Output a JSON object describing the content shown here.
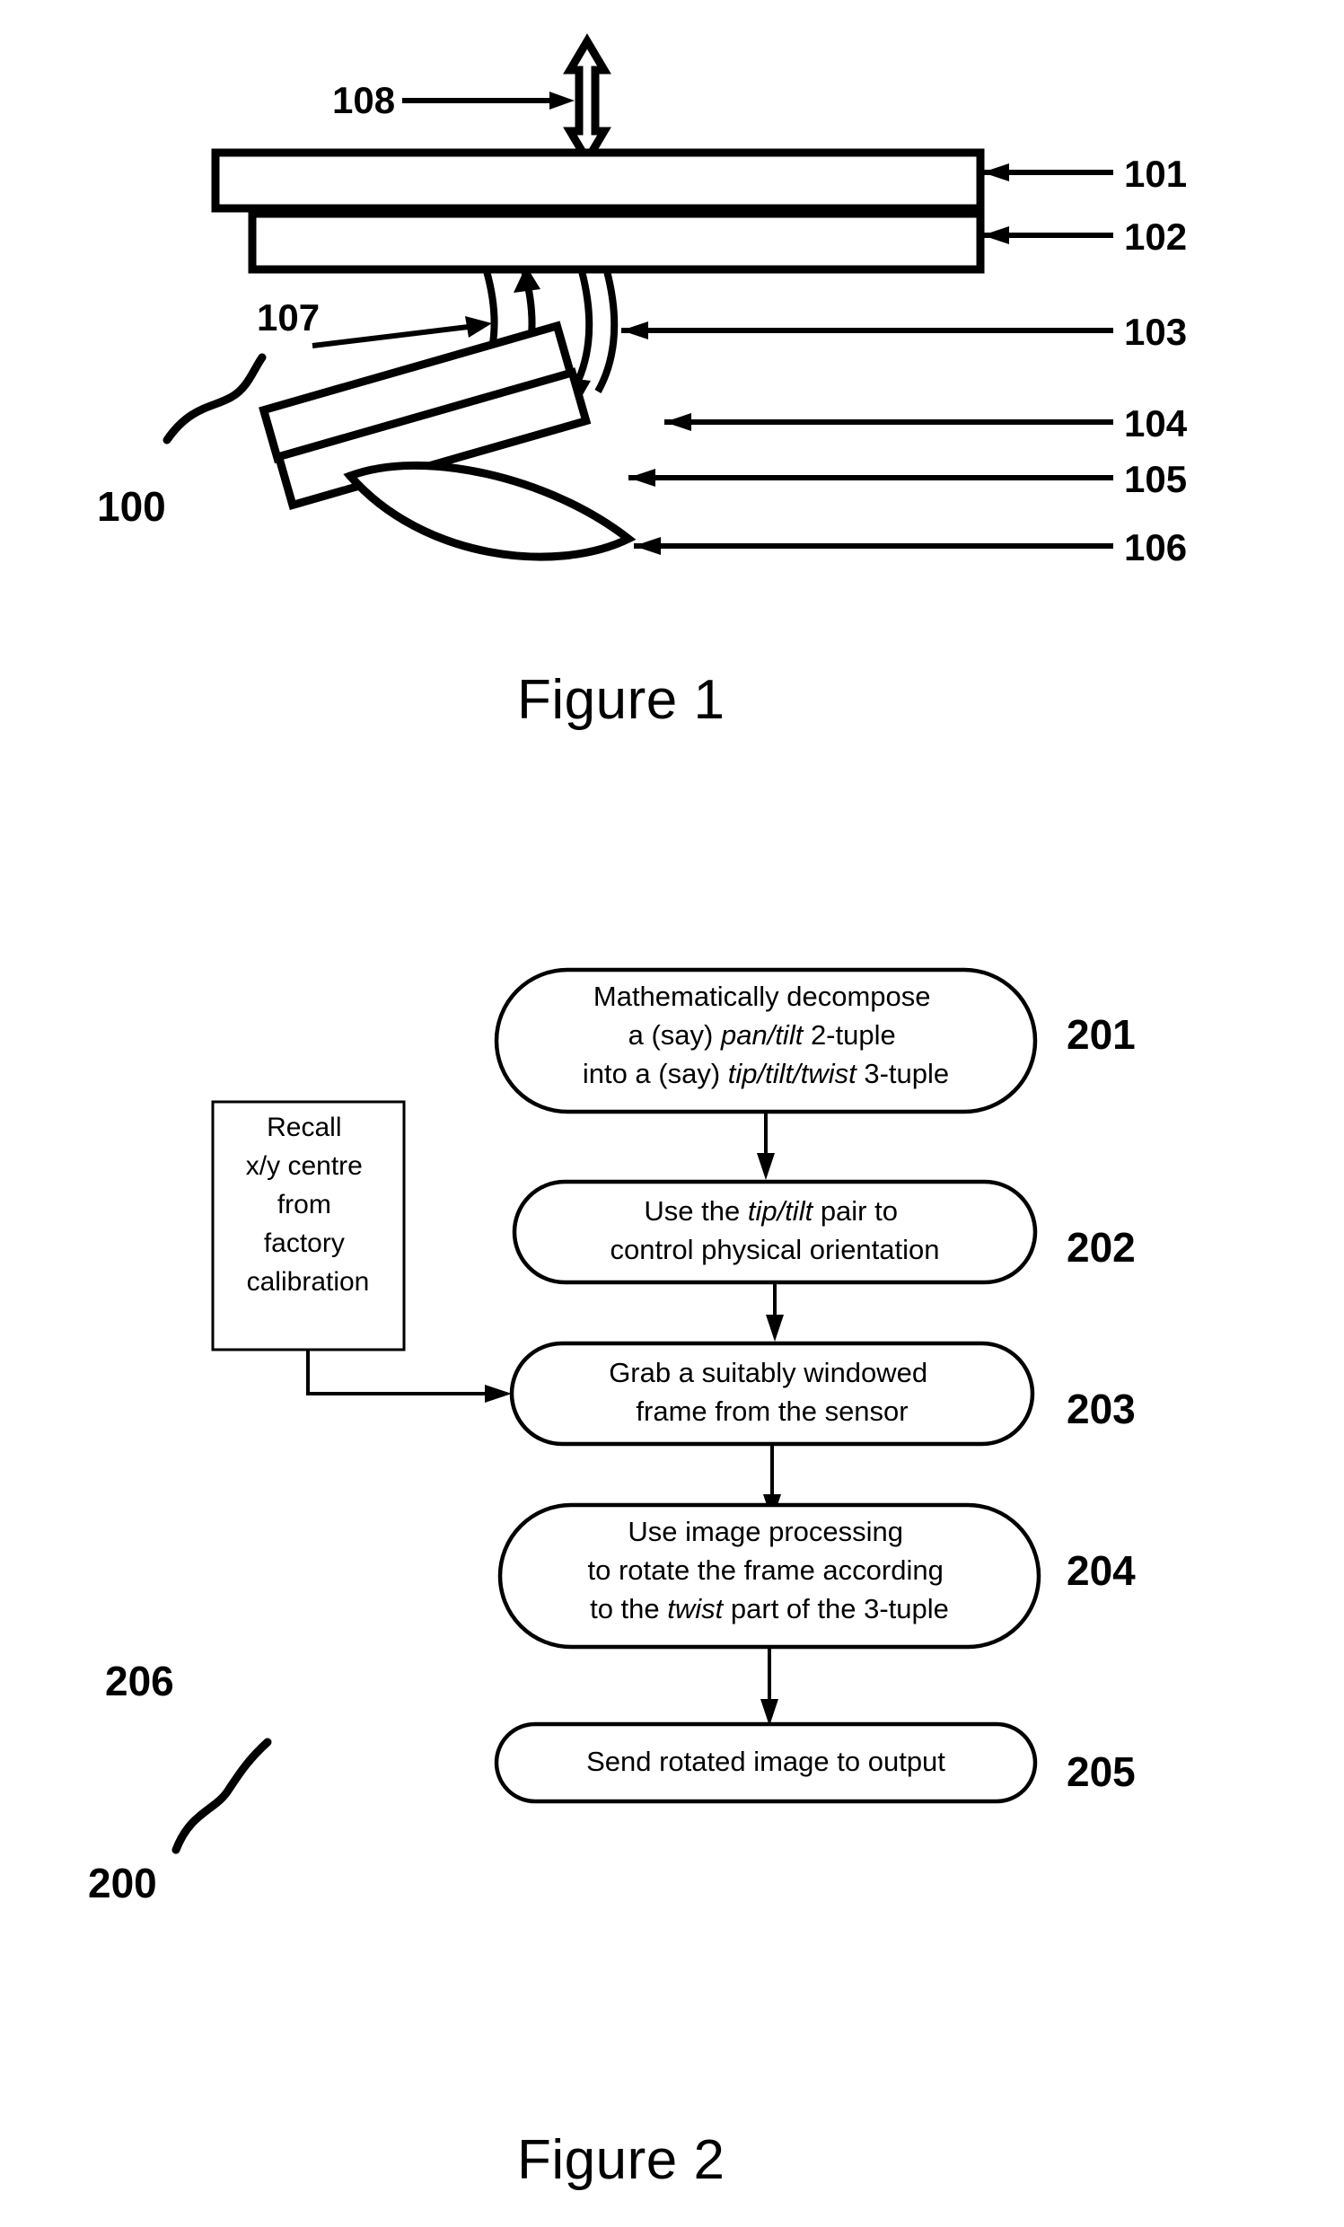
{
  "document": {
    "type": "patent-drawing-sheet",
    "background_color": "#ffffff",
    "line_color": "#000000"
  },
  "figure1": {
    "caption": "Figure 1",
    "assembly_ref": "100",
    "callouts": {
      "motion_arrow": "108",
      "flexure": "107"
    },
    "right_labels": [
      {
        "ref": "101",
        "name": "top-plate"
      },
      {
        "ref": "102",
        "name": "second-plate"
      },
      {
        "ref": "103",
        "name": "flexure-legs"
      },
      {
        "ref": "104",
        "name": "tilted-plate-upper"
      },
      {
        "ref": "105",
        "name": "tilted-plate-lower"
      },
      {
        "ref": "106",
        "name": "lens"
      }
    ]
  },
  "figure2": {
    "caption": "Figure 2",
    "flow_ref": "200",
    "side_box": {
      "ref": "206",
      "shape": "rectangle",
      "lines": [
        "Recall",
        "x/y centre",
        "from",
        "factory",
        "calibration"
      ]
    },
    "steps": [
      {
        "ref": "201",
        "shape": "stadium",
        "lines": [
          [
            {
              "t": "Mathematically decompose",
              "i": false
            }
          ],
          [
            {
              "t": "a (say) ",
              "i": false
            },
            {
              "t": "pan/tilt",
              "i": true
            },
            {
              "t": " 2-tuple",
              "i": false
            }
          ],
          [
            {
              "t": "into a (say) ",
              "i": false
            },
            {
              "t": "tip/tilt/twist",
              "i": true
            },
            {
              "t": " 3-tuple",
              "i": false
            }
          ]
        ]
      },
      {
        "ref": "202",
        "shape": "stadium",
        "lines": [
          [
            {
              "t": "Use the ",
              "i": false
            },
            {
              "t": "tip/tilt",
              "i": true
            },
            {
              "t": " pair to",
              "i": false
            }
          ],
          [
            {
              "t": "control physical orientation",
              "i": false
            }
          ]
        ]
      },
      {
        "ref": "203",
        "shape": "stadium",
        "lines": [
          [
            {
              "t": "Grab a suitably windowed",
              "i": false
            }
          ],
          [
            {
              "t": "frame from the sensor",
              "i": false
            }
          ]
        ]
      },
      {
        "ref": "204",
        "shape": "stadium",
        "lines": [
          [
            {
              "t": "Use image processing",
              "i": false
            }
          ],
          [
            {
              "t": "to rotate the frame according",
              "i": false
            }
          ],
          [
            {
              "t": "to the ",
              "i": false
            },
            {
              "t": "twist",
              "i": true
            },
            {
              "t": " part of the 3-tuple",
              "i": false
            }
          ]
        ]
      },
      {
        "ref": "205",
        "shape": "stadium",
        "lines": [
          [
            {
              "t": "Send rotated image to output",
              "i": false
            }
          ]
        ]
      }
    ]
  }
}
